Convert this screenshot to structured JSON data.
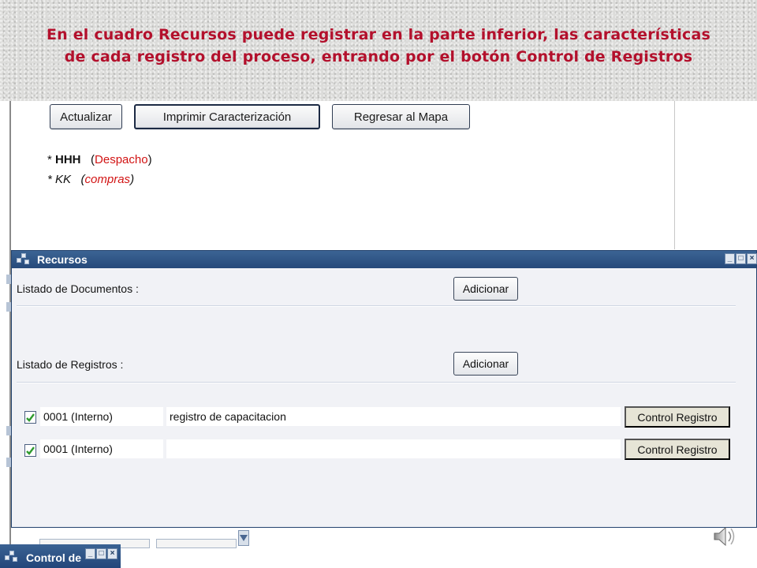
{
  "banner": {
    "line1": "En el cuadro Recursos puede registrar en la parte inferior, las características",
    "line2": "de cada registro del proceso, entrando por el botón Control de Registros"
  },
  "toolbar": {
    "actualizar": "Actualizar",
    "imprimir": "Imprimir Caracterización",
    "regresar": "Regresar al Mapa"
  },
  "procesos": [
    {
      "prefix": "* ",
      "name": "HHH",
      "area": "Despacho"
    },
    {
      "prefix": "* ",
      "name": "KK",
      "area": "compras"
    }
  ],
  "recursos": {
    "title": "Recursos",
    "documentos_label": "Listado de Documentos :",
    "registros_label": "Listado de Registros :",
    "adicionar": "Adicionar",
    "rows": [
      {
        "checked": true,
        "code": "0001  (Interno)",
        "description": "registro de capacitacion",
        "button": "Control Registro"
      },
      {
        "checked": true,
        "code": "0001  (Interno)",
        "description": "",
        "button": "Control Registro"
      }
    ]
  },
  "control_window": {
    "title": "Control de"
  },
  "colors": {
    "banner_text": "#b3102c",
    "titlebar": "#26497a",
    "check": "#2e9a2e",
    "process_area": "#d21414"
  },
  "icons": [
    "window-menu-icon",
    "minimize-icon",
    "maximize-icon",
    "close-icon",
    "checkmark-icon",
    "scroll-down-arrow-icon",
    "speaker-icon"
  ]
}
